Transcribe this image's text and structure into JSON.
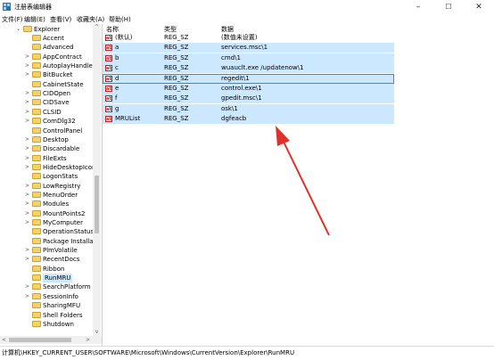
{
  "window": {
    "title": "注册表编辑器",
    "minimize": "–",
    "maximize": "☐",
    "close": "✕"
  },
  "menu": [
    "文件(F)",
    "编辑(E)",
    "查看(V)",
    "收藏夹(A)",
    "帮助(H)"
  ],
  "tree": {
    "parent": "Explorer",
    "items": [
      {
        "label": "Accent",
        "has_children": false
      },
      {
        "label": "Advanced",
        "has_children": false
      },
      {
        "label": "AppContract",
        "has_children": true
      },
      {
        "label": "AutoplayHandlers",
        "has_children": true
      },
      {
        "label": "BitBucket",
        "has_children": true
      },
      {
        "label": "CabinetState",
        "has_children": false
      },
      {
        "label": "CIDOpen",
        "has_children": true
      },
      {
        "label": "CIDSave",
        "has_children": true
      },
      {
        "label": "CLSID",
        "has_children": true
      },
      {
        "label": "ComDlg32",
        "has_children": true
      },
      {
        "label": "ControlPanel",
        "has_children": false
      },
      {
        "label": "Desktop",
        "has_children": true
      },
      {
        "label": "Discardable",
        "has_children": true
      },
      {
        "label": "FileExts",
        "has_children": true
      },
      {
        "label": "HideDesktopIcons",
        "has_children": true
      },
      {
        "label": "LogonStats",
        "has_children": false
      },
      {
        "label": "LowRegistry",
        "has_children": true
      },
      {
        "label": "MenuOrder",
        "has_children": true
      },
      {
        "label": "Modules",
        "has_children": true
      },
      {
        "label": "MountPoints2",
        "has_children": true
      },
      {
        "label": "MyComputer",
        "has_children": true
      },
      {
        "label": "OperationStatusM",
        "has_children": false
      },
      {
        "label": "Package Installati",
        "has_children": false
      },
      {
        "label": "PlmVolatile",
        "has_children": true
      },
      {
        "label": "RecentDocs",
        "has_children": true
      },
      {
        "label": "Ribbon",
        "has_children": false
      },
      {
        "label": "RunMRU",
        "has_children": false,
        "selected": true
      },
      {
        "label": "SearchPlatform",
        "has_children": true
      },
      {
        "label": "SessionInfo",
        "has_children": true
      },
      {
        "label": "SharingMFU",
        "has_children": false
      },
      {
        "label": "Shell Folders",
        "has_children": false
      },
      {
        "label": "Shutdown",
        "has_children": false
      }
    ]
  },
  "columns": {
    "name": "名称",
    "type": "类型",
    "data": "数据"
  },
  "values": [
    {
      "name": "(默认)",
      "type": "REG_SZ",
      "data": "(数值未设置)",
      "highlight": false
    },
    {
      "name": "a",
      "type": "REG_SZ",
      "data": "services.msc\\1",
      "highlight": true
    },
    {
      "name": "b",
      "type": "REG_SZ",
      "data": "cmd\\1",
      "highlight": true
    },
    {
      "name": "c",
      "type": "REG_SZ",
      "data": "wuauclt.exe /updatenow\\1",
      "highlight": true
    },
    {
      "name": "d",
      "type": "REG_SZ",
      "data": "regedit\\1",
      "highlight": true,
      "focused": true
    },
    {
      "name": "e",
      "type": "REG_SZ",
      "data": "control.exe\\1",
      "highlight": true
    },
    {
      "name": "f",
      "type": "REG_SZ",
      "data": "gpedit.msc\\1",
      "highlight": true
    },
    {
      "name": "g",
      "type": "REG_SZ",
      "data": "osk\\1",
      "highlight": true
    },
    {
      "name": "MRUList",
      "type": "REG_SZ",
      "data": "dgfeacb",
      "highlight": true
    }
  ],
  "icons": {
    "value": "ab",
    "folder": "folder-icon"
  },
  "status": "计算机\\HKEY_CURRENT_USER\\SOFTWARE\\Microsoft\\Windows\\CurrentVersion\\Explorer\\RunMRU",
  "colors": {
    "selection": "#cce8ff",
    "annotation_arrow": "#e0302a",
    "folder": "#f3d36a"
  }
}
